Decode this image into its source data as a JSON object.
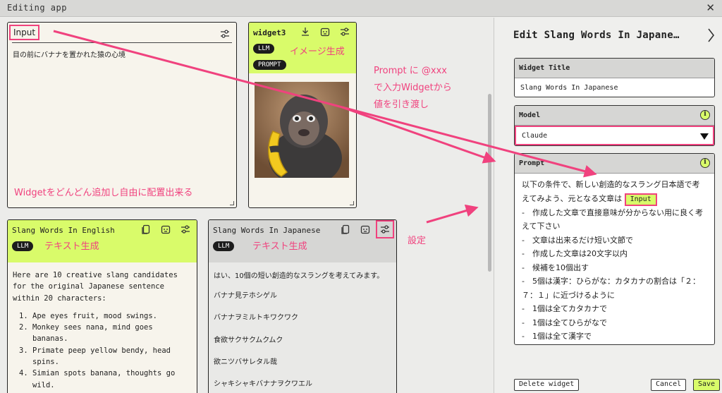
{
  "window": {
    "title": "Editing app"
  },
  "input_widget": {
    "label": "Input",
    "text": "目の前にバナナを置かれた猿の心境"
  },
  "widget3": {
    "name": "widget3",
    "tags": [
      "LLM",
      "PROMPT"
    ]
  },
  "english_widget": {
    "name": "Slang Words In English",
    "tag": "LLM",
    "intro": "Here are 10 creative slang candidates for the original Japanese sentence within 20 characters:",
    "items": [
      "Ape eyes fruit, mood swings.",
      "Monkey sees nana, mind goes bananas.",
      "Primate peep yellow bendy, head spins.",
      "Simian spots banana, thoughts go wild."
    ]
  },
  "japanese_widget": {
    "name": "Slang Words In Japanese",
    "tag": "LLM",
    "intro": "はい、10個の短い創造的なスラングを考えてみます。",
    "items": [
      "バナナ見テホシゲル",
      "バナナヲミルトキワクワク",
      "食欲サクサクムクムク",
      "欲ニツバサレタル哉",
      "シャキシャキバナナヲクワエル"
    ]
  },
  "panel": {
    "title": "Edit Slang Words In Japane…",
    "widget_title_label": "Widget Title",
    "widget_title_value": "Slang Words In Japanese",
    "model_label": "Model",
    "model_value": "Claude",
    "prompt_label": "Prompt",
    "prompt_intro": "以下の条件で、新しい創造的なスラング日本語で考えてみよう、元となる文章は",
    "prompt_chip": "Input",
    "prompt_lines": [
      "-　作成した文章で直接意味が分からない用に良く考えて下さい",
      "-　文章は出来るだけ短い文節で",
      "-　作成した文章は20文字以内",
      "-　候補を10個出す",
      "-　5個は漢字：ひらがな：カタカナの割合は「２：７：１」に近づけるように",
      "-　1個は全てカタカナで",
      "-　1個は全てひらがなで",
      "-　1個は全て漢字で"
    ],
    "delete_label": "Delete widget",
    "cancel_label": "Cancel",
    "save_label": "Save"
  },
  "annotations": {
    "image_gen": "イメージ生成",
    "prompt_note_1": "Prompt に @xxx",
    "prompt_note_2": "で入力Widgetから",
    "prompt_note_3": "値を引き渡し",
    "widget_note": "Widgetをどんどん追加し自由に配置出来る",
    "text_gen_1": "テキスト生成",
    "text_gen_2": "テキスト生成",
    "settings": "設定"
  },
  "colors": {
    "accent": "#d9fb6a",
    "annotation": "#f0427e",
    "dark": "#1c1c1c"
  }
}
